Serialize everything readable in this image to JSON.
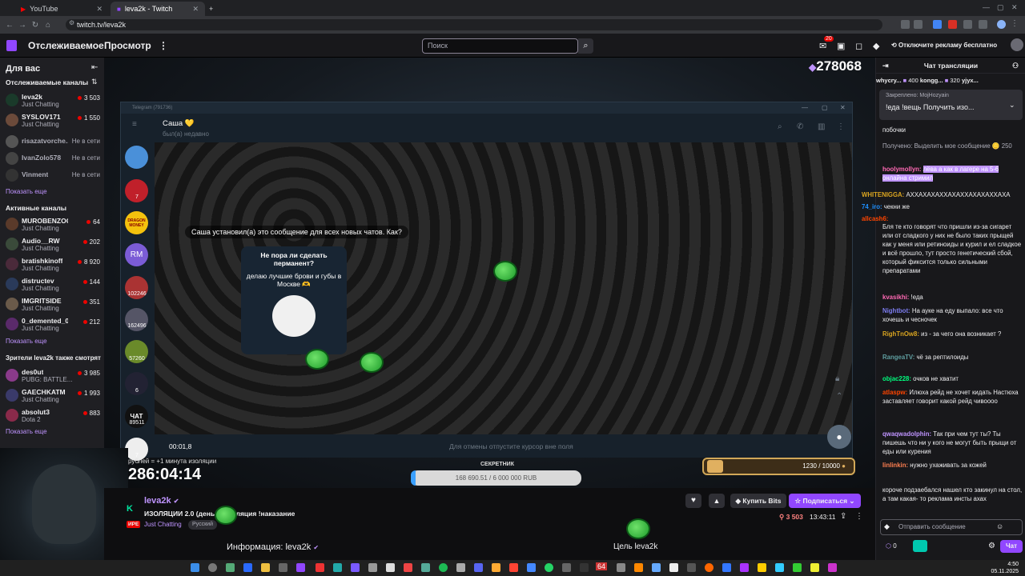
{
  "browser": {
    "tabs": [
      {
        "label": "YouTube"
      },
      {
        "label": "leva2k - Twitch"
      }
    ],
    "new_tab": "+",
    "url": "twitch.tv/leva2k"
  },
  "topnav": {
    "following": "Отслеживаемое",
    "browse": "Просмотр",
    "search_placeholder": "Поиск",
    "notif_count": "20",
    "adfree": "Отключите рекламу бесплатно"
  },
  "sidebar": {
    "for_you": "Для вас",
    "followed_heading": "Отслеживаемые каналы",
    "followed": [
      {
        "name": "leva2k",
        "game": "Just Chatting",
        "viewers": "3 503",
        "live": true
      },
      {
        "name": "SYSLOV171",
        "game": "Just Chatting",
        "viewers": "1 550",
        "live": true
      },
      {
        "name": "risazatvorche...",
        "game": "",
        "viewers": "Не в сети",
        "live": false
      },
      {
        "name": "IvanZolo578",
        "game": "",
        "viewers": "Не в сети",
        "live": false
      },
      {
        "name": "Vinment",
        "game": "",
        "viewers": "Не в сети",
        "live": false
      }
    ],
    "show_more": "Показать еще",
    "active_heading": "Активные каналы",
    "active": [
      {
        "name": "MUROBENZOO",
        "game": "Just Chatting",
        "viewers": "64"
      },
      {
        "name": "Audio__RW",
        "game": "Just Chatting",
        "viewers": "202"
      },
      {
        "name": "bratishkinoff",
        "game": "Just Chatting",
        "viewers": "8 920"
      },
      {
        "name": "distructev",
        "game": "Just Chatting",
        "viewers": "144"
      },
      {
        "name": "IMGRITSIDE",
        "game": "Just Chatting",
        "viewers": "351"
      },
      {
        "name": "0_demented_0",
        "game": "Just Chatting",
        "viewers": "212"
      }
    ],
    "also_heading": "Зрители leva2k также смотрят",
    "also": [
      {
        "name": "des0ut",
        "game": "PUBG: BATTLE...",
        "viewers": "3 985"
      },
      {
        "name": "GAECHKATM",
        "game": "Just Chatting",
        "viewers": "1 993"
      },
      {
        "name": "absolut3",
        "game": "Dota 2",
        "viewers": "883"
      }
    ]
  },
  "stream": {
    "viewer_total": "278068",
    "timer_label": "рублей = +1 минута изоляции",
    "timer": "286:04:14",
    "goal_label": "СЕКРЕТНИК",
    "goal_value": "168 690.51 / 6 000 000 RUB",
    "goal_progress": 0.028,
    "subgoal_value": "1230 / 10000"
  },
  "telegram": {
    "window_title": "Telegram (791736)",
    "contact": "Саша 💛",
    "last_seen": "был(а) недавно",
    "service_msg": "Саша установил(а) это сообщение для всех новых чатов. Как?",
    "bubble_title": "Не пора ли сделать перманент?",
    "bubble_text": "делаю лучшие брови и губы в Москве 🫶",
    "rec_time": "00:01,8",
    "rec_hint": "Для отмены отпустите курсор вне поля",
    "folders": [
      {
        "label": "",
        "count": ""
      },
      {
        "label": "",
        "count": "7"
      },
      {
        "label": "DRAGON MONEY",
        "count": ""
      },
      {
        "label": "RM",
        "count": ""
      },
      {
        "label": "",
        "count": "102246"
      },
      {
        "label": "",
        "count": "162496"
      },
      {
        "label": "",
        "count": "57260"
      },
      {
        "label": "",
        "count": "6"
      },
      {
        "label": "ЧАТ",
        "count": "89511"
      },
      {
        "label": "",
        "count": "7"
      }
    ]
  },
  "info": {
    "name": "leva2k",
    "title": "ИЗОЛЯЦИИ 2.0 (день 1) изоляция !наказание",
    "game": "Just Chatting",
    "tag": "Русский",
    "live": "ИРЕ",
    "bits": "Купить Bits",
    "subscribe": "Подписаться",
    "viewers": "3 503",
    "uptime": "13:43:11",
    "about": "Информация: leva2k",
    "goal": "Цель leva2k"
  },
  "chat": {
    "title": "Чат трансляции",
    "leaders": [
      {
        "name": "whycry...",
        "value": "400"
      },
      {
        "name": "kongg...",
        "value": "320"
      },
      {
        "name": "yjyx...",
        "value": ""
      }
    ],
    "pinned_by": "Закреплено: MojHozyain",
    "pinned_text": "!еда !вещь Получить изо...",
    "messages": [
      {
        "user": "",
        "text": "побочки",
        "color": "#efeff1"
      },
      {
        "user": "",
        "text": "Получено: Выделить мое сообщение 🪙 250",
        "color": "#adadb8"
      },
      {
        "user": "hoolymollyn:",
        "text": "лёва а как в лагере на 5-6 онлайна стримил",
        "color": "#ff69b4"
      },
      {
        "user": "WHITENIGGA:",
        "text": "АХХАХАХАХХАХАХХАХАХАХХАХА",
        "color": "#daa520"
      },
      {
        "user": "74_iro:",
        "text": "чекни же",
        "color": "#1e90ff"
      },
      {
        "user": "allcash6:",
        "text": "",
        "color": "#ff4500"
      },
      {
        "user": "",
        "text": "Бля те кто говорят что пришли из-за сигарет или от сладкого у них не было таких прыщей как у меня или ретиноиды и курил и ел сладкое и всё прошло, тут просто генетический сбой, который фиксится только сильными препаратами",
        "color": "#efeff1"
      },
      {
        "user": "kvasikhi:",
        "text": "!еда",
        "color": "#ff69b4"
      },
      {
        "user": "Nightbot:",
        "text": "На ауке на еду выпало: все что хочешь и чесночек",
        "color": "#7c7cef"
      },
      {
        "user": "RighTnOw8:",
        "text": "из - за чего она возникает ?",
        "color": "#daa520"
      },
      {
        "user": "RangeaTV:",
        "text": "чё за рептилоиды",
        "color": "#5f9ea0"
      },
      {
        "user": "objac228:",
        "text": "очков не хватит",
        "color": "#00ff7f"
      },
      {
        "user": "atlaspw:",
        "text": "Илюха рейд не хочет кидать Настюха заставляет говорит какой рейд чивоооо",
        "color": "#ff4500"
      },
      {
        "user": "qwaqwadolphin:",
        "text": "Так при чем тут ты? Ты пишешь что ни у кого не могут быть прыщи от еды или курения",
        "color": "#bf94ff"
      },
      {
        "user": "linlinkin:",
        "text": "нужно ухаживать за кожей",
        "color": "#ff7f50"
      },
      {
        "user": "",
        "text": "корочe подзаебался нашел кто закинул на стол, а там какая- то реклама инсты ахах",
        "color": "#efeff1"
      }
    ],
    "input_placeholder": "Отправить сообщение",
    "points": "0",
    "send": "Чат"
  },
  "taskbar": {
    "clock_time": "4:50",
    "clock_date": "05.11.2025",
    "badge": "64"
  }
}
